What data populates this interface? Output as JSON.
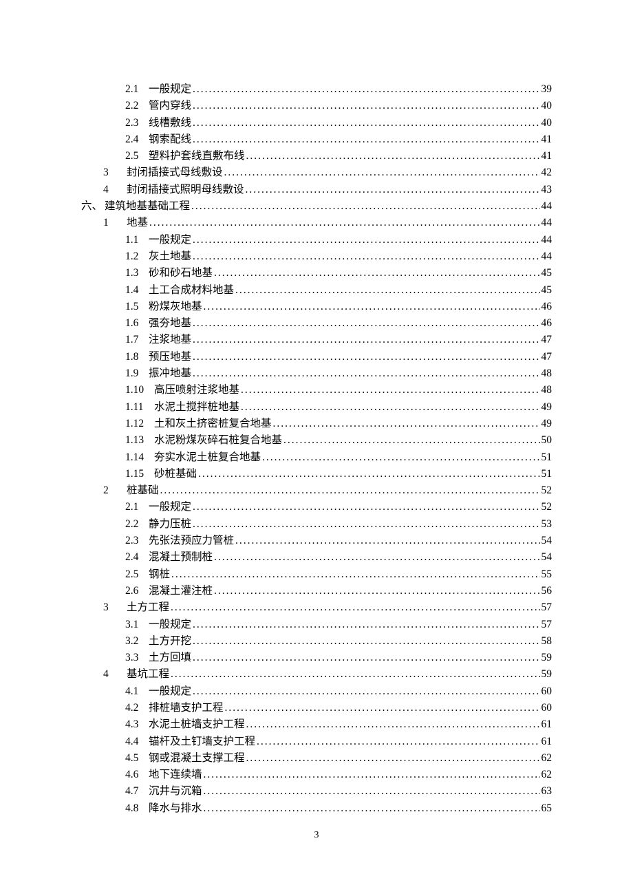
{
  "page_number": "3",
  "entries": [
    {
      "level": 2,
      "num": "2.1",
      "title": "一般规定",
      "page": "39"
    },
    {
      "level": 2,
      "num": "2.2",
      "title": "管内穿线",
      "page": "40"
    },
    {
      "level": 2,
      "num": "2.3",
      "title": "线槽敷线",
      "page": "40"
    },
    {
      "level": 2,
      "num": "2.4",
      "title": "钢索配线",
      "page": "41"
    },
    {
      "level": 2,
      "num": "2.5",
      "title": "塑料护套线直敷布线",
      "page": "41"
    },
    {
      "level": 1,
      "num": "3",
      "title": "封闭插接式母线敷设",
      "page": "42"
    },
    {
      "level": 1,
      "num": "4",
      "title": "封闭插接式照明母线敷设",
      "page": "43"
    },
    {
      "level": 0,
      "num": "六、",
      "title": "建筑地基基础工程",
      "page": "44"
    },
    {
      "level": 1,
      "num": "1",
      "title": "地基",
      "page": "44"
    },
    {
      "level": 2,
      "num": "1.1",
      "title": "一般规定",
      "page": "44"
    },
    {
      "level": 2,
      "num": "1.2",
      "title": "灰土地基",
      "page": "44"
    },
    {
      "level": 2,
      "num": "1.3",
      "title": "砂和砂石地基",
      "page": "45"
    },
    {
      "level": 2,
      "num": "1.4",
      "title": "土工合成材料地基",
      "page": "45"
    },
    {
      "level": 2,
      "num": "1.5",
      "title": "粉煤灰地基",
      "page": "46"
    },
    {
      "level": 2,
      "num": "1.6",
      "title": "强夯地基",
      "page": "46"
    },
    {
      "level": 2,
      "num": "1.7",
      "title": "注浆地基",
      "page": "47"
    },
    {
      "level": 2,
      "num": "1.8",
      "title": "预压地基",
      "page": "47"
    },
    {
      "level": 2,
      "num": "1.9",
      "title": "振冲地基",
      "page": "48"
    },
    {
      "level": 2,
      "num": "1.10",
      "title": "高压喷射注浆地基",
      "page": "48",
      "wide": true
    },
    {
      "level": 2,
      "num": "1.11",
      "title": "水泥土搅拌桩地基",
      "page": "49",
      "wide": true
    },
    {
      "level": 2,
      "num": "1.12",
      "title": "土和灰土挤密桩复合地基",
      "page": "49",
      "wide": true
    },
    {
      "level": 2,
      "num": "1.13",
      "title": "水泥粉煤灰碎石桩复合地基",
      "page": "50",
      "wide": true
    },
    {
      "level": 2,
      "num": "1.14",
      "title": "夯实水泥土桩复合地基",
      "page": "51",
      "wide": true
    },
    {
      "level": 2,
      "num": "1.15",
      "title": "砂桩基础",
      "page": "51",
      "wide": true
    },
    {
      "level": 1,
      "num": "2",
      "title": "桩基础",
      "page": "52"
    },
    {
      "level": 2,
      "num": "2.1",
      "title": "一般规定",
      "page": "52"
    },
    {
      "level": 2,
      "num": "2.2",
      "title": "静力压桩",
      "page": "53"
    },
    {
      "level": 2,
      "num": "2.3",
      "title": "先张法预应力管桩",
      "page": "54"
    },
    {
      "level": 2,
      "num": "2.4",
      "title": "混凝土预制桩",
      "page": "54"
    },
    {
      "level": 2,
      "num": "2.5",
      "title": "钢桩",
      "page": "55"
    },
    {
      "level": 2,
      "num": "2.6",
      "title": "混凝土灌注桩",
      "page": "56"
    },
    {
      "level": 1,
      "num": "3",
      "title": "土方工程",
      "page": "57"
    },
    {
      "level": 2,
      "num": "3.1",
      "title": "一般规定",
      "page": "57"
    },
    {
      "level": 2,
      "num": "3.2",
      "title": "土方开挖",
      "page": "58"
    },
    {
      "level": 2,
      "num": "3.3",
      "title": "土方回填",
      "page": "59"
    },
    {
      "level": 1,
      "num": "4",
      "title": "基坑工程",
      "page": "59"
    },
    {
      "level": 2,
      "num": "4.1",
      "title": "一般规定",
      "page": "60"
    },
    {
      "level": 2,
      "num": "4.2",
      "title": "排桩墙支护工程",
      "page": "60"
    },
    {
      "level": 2,
      "num": "4.3",
      "title": "水泥土桩墙支护工程",
      "page": "61"
    },
    {
      "level": 2,
      "num": "4.4",
      "title": "锚杆及土钉墙支护工程",
      "page": "61"
    },
    {
      "level": 2,
      "num": "4.5",
      "title": "钢或混凝土支撑工程",
      "page": "62"
    },
    {
      "level": 2,
      "num": "4.6",
      "title": "地下连续墙",
      "page": "62"
    },
    {
      "level": 2,
      "num": "4.7",
      "title": "沉井与沉箱",
      "page": "63"
    },
    {
      "level": 2,
      "num": "4.8",
      "title": "降水与排水",
      "page": "65"
    }
  ]
}
